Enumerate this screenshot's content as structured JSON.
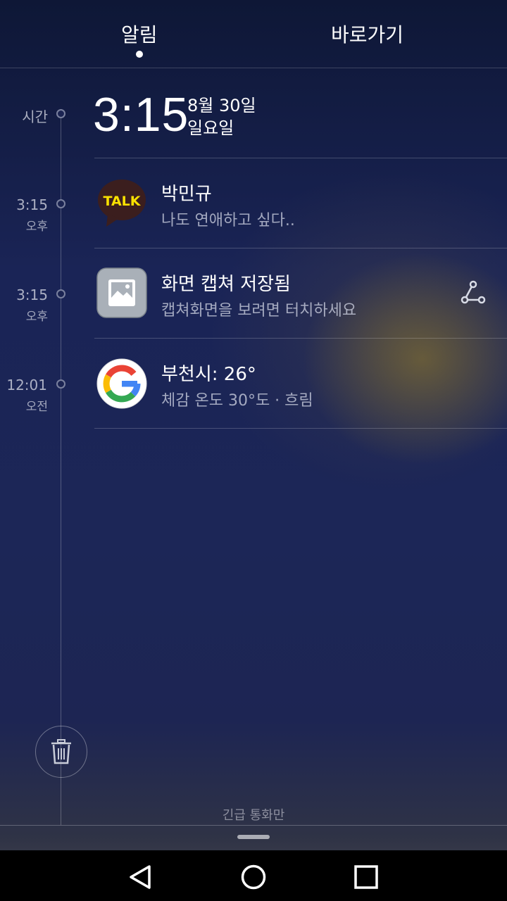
{
  "tabs": [
    {
      "label": "알림",
      "active": true
    },
    {
      "label": "바로가기",
      "active": false
    }
  ],
  "header": {
    "time_label": "시간",
    "clock": "3:15",
    "date": "8월 30일",
    "weekday": "일요일"
  },
  "notifications": [
    {
      "time": "3:15",
      "ampm": "오후",
      "icon": "kakaotalk-icon",
      "icon_text": "TALK",
      "title": "박민규",
      "text": "나도 연애하고 싶다.."
    },
    {
      "time": "3:15",
      "ampm": "오후",
      "icon": "gallery-icon",
      "title": "화면 캡쳐 저장됨",
      "text": "캡쳐화면을 보려면 터치하세요",
      "action_icon": "share-icon"
    },
    {
      "time": "12:01",
      "ampm": "오전",
      "icon": "google-icon",
      "title": "부천시: 26°",
      "text": "체감 온도 30°도 · 흐림"
    }
  ],
  "footer": {
    "clear_icon": "trash-icon",
    "emergency_text": "긴급 통화만"
  },
  "navbar": [
    "back-icon",
    "home-icon",
    "recents-icon"
  ],
  "colors": {
    "kakao_yellow": "#f9e000",
    "kakao_brown": "#3b1e1e",
    "background": "#1c2657"
  }
}
